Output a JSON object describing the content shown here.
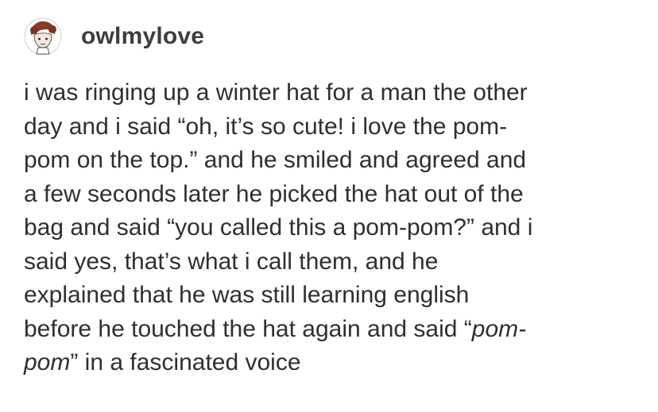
{
  "post": {
    "username": "owlmylove",
    "lines": [
      [
        {
          "text": "i was ringing up a winter hat for a man the other",
          "italic": false
        }
      ],
      [
        {
          "text": "day and i said “oh, it’s so cute! i love the pom-",
          "italic": false
        }
      ],
      [
        {
          "text": "pom on the top.” and he smiled and agreed and",
          "italic": false
        }
      ],
      [
        {
          "text": "a few seconds later he picked the hat out of the",
          "italic": false
        }
      ],
      [
        {
          "text": "bag and said “you called this a pom-pom?” and i",
          "italic": false
        }
      ],
      [
        {
          "text": "said yes, that’s what i call them, and he",
          "italic": false
        }
      ],
      [
        {
          "text": "explained that he was still learning english",
          "italic": false
        }
      ],
      [
        {
          "text": "before he touched the hat again and said “",
          "italic": false
        },
        {
          "text": "pom-",
          "italic": true
        }
      ],
      [
        {
          "text": "pom",
          "italic": true
        },
        {
          "text": "” in a fascinated voice",
          "italic": false
        }
      ]
    ]
  },
  "colors": {
    "background": "#ffffff",
    "text": "#2f2f2f",
    "username": "#3d3d3d"
  },
  "icons": {
    "avatar": "avatar-illustration"
  }
}
